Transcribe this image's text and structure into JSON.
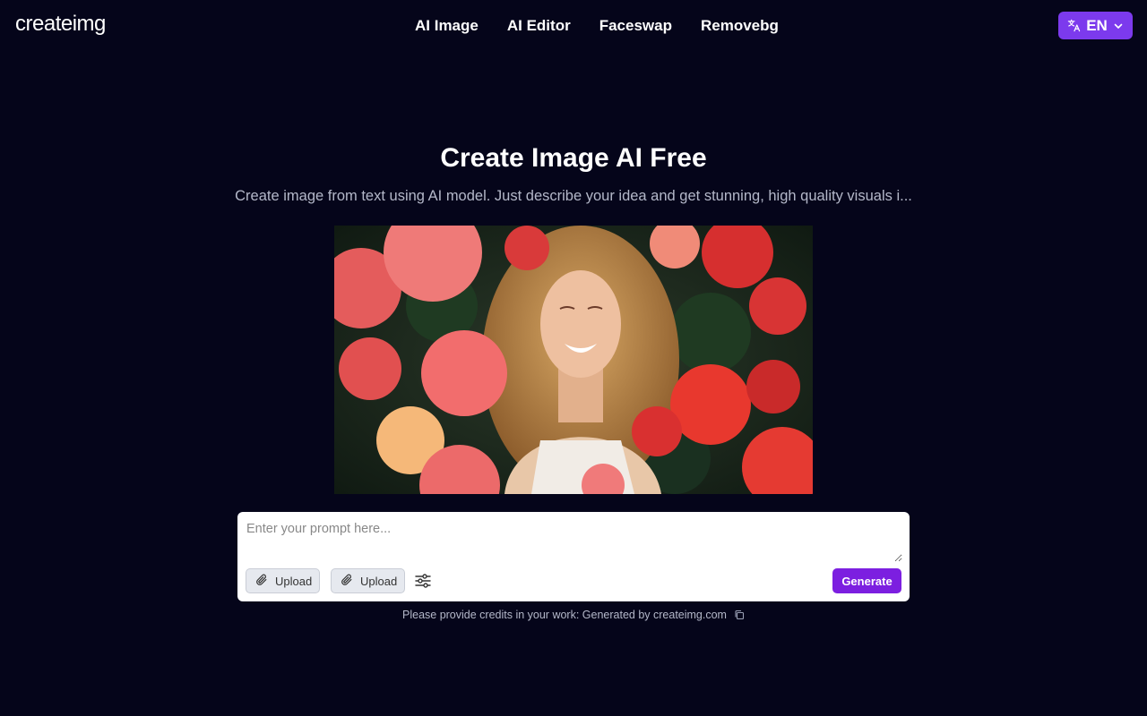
{
  "nav": {
    "logo": "createimg",
    "links": [
      "AI Image",
      "AI Editor",
      "Faceswap",
      "Removebg"
    ],
    "language": {
      "code": "EN",
      "icon": "translate-icon"
    }
  },
  "hero": {
    "title": "Create Image AI Free",
    "subtitle": "Create image from text using AI model. Just describe your idea and get stunning, high quality visuals i..."
  },
  "prompt": {
    "placeholder": "Enter your prompt here...",
    "upload_label_1": "Upload",
    "upload_label_2": "Upload",
    "generate_label": "Generate"
  },
  "credit": {
    "text": "Please provide credits in your work: Generated by createimg.com"
  },
  "colors": {
    "background": "#05051a",
    "accent": "#7c3aed",
    "generate": "#7c1fe0"
  }
}
